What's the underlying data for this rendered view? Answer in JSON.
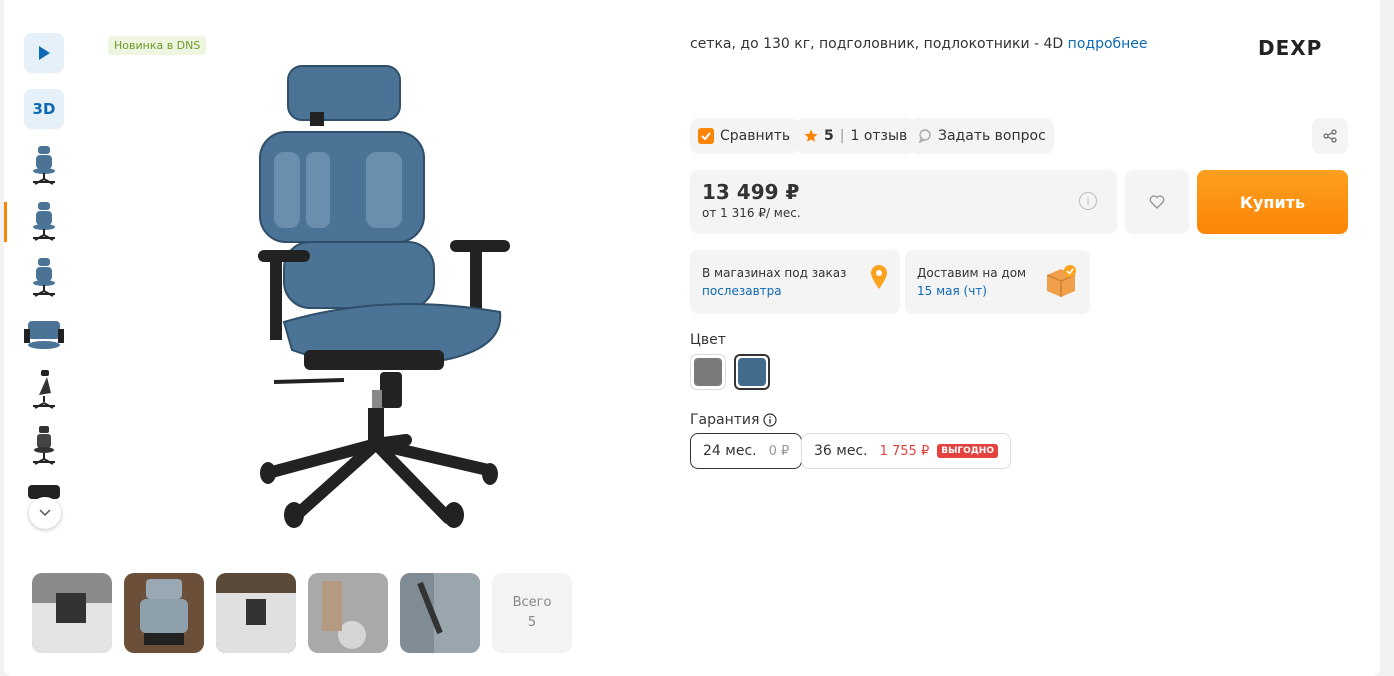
{
  "badge_new": "Новинка в DNS",
  "left_nav": {
    "three_d_label": "3D"
  },
  "photos": {
    "more_label": "Всего",
    "more_count": "5"
  },
  "specs": {
    "text": "сетка, до 130 кг, подголовник, подлокотники - 4D",
    "more_link": "подробнее"
  },
  "brand": "DEXP",
  "actions": {
    "compare_label": "Сравнить",
    "rating": "5",
    "reviews": "1 отзыв",
    "ask_label": "Задать вопрос"
  },
  "price": {
    "value": "13 499 ₽",
    "credit": "от 1 316 ₽/ мес."
  },
  "buy_label": "Купить",
  "delivery": {
    "store_title": "В магазинах под заказ",
    "store_value": "послезавтра",
    "home_title": "Доставим на дом",
    "home_value": "15 мая (чт)"
  },
  "color": {
    "label": "Цвет",
    "options": [
      "#7a7a7a",
      "#426b8e"
    ],
    "selected": 1
  },
  "warranty": {
    "label": "Гарантия",
    "options": [
      {
        "term": "24 мес.",
        "price": "0 ₽"
      },
      {
        "term": "36 мес.",
        "price": "1 755 ₽",
        "badge": "выгодно"
      }
    ]
  },
  "colors": {
    "accent": "#fc8507",
    "link": "#0e69b4",
    "chair_mesh": "#4a7396"
  }
}
